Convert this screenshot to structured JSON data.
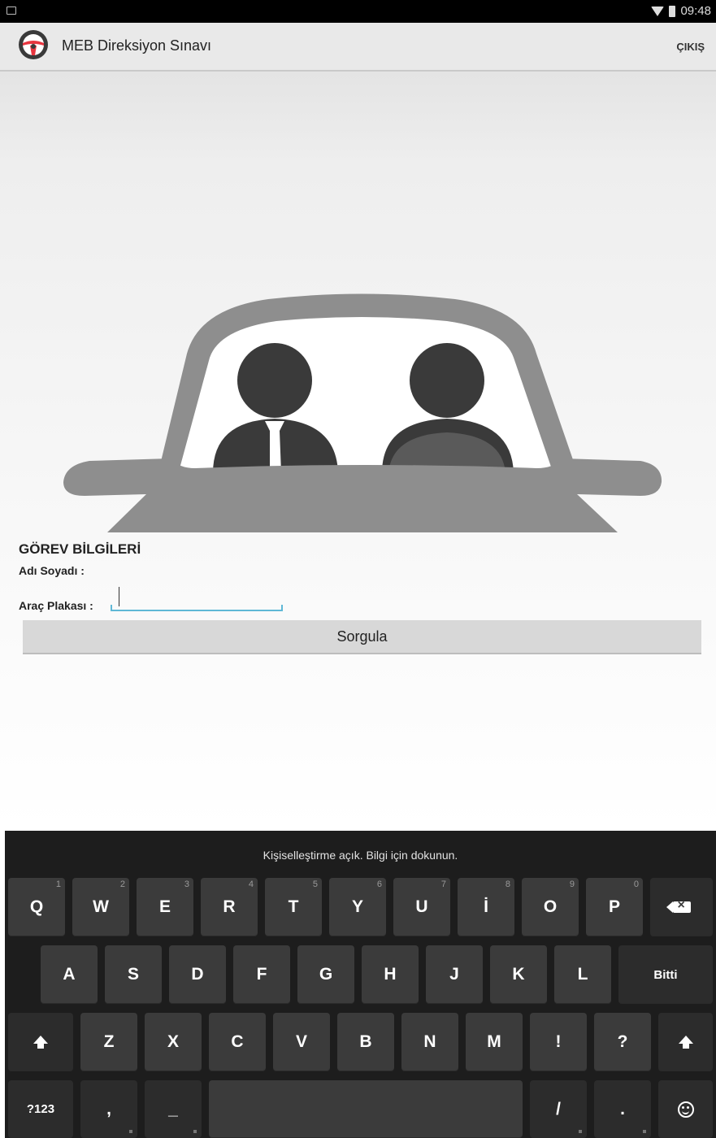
{
  "status_bar": {
    "time": "09:48",
    "icons": [
      "notification-icon",
      "wifi-icon",
      "battery-icon"
    ]
  },
  "app_bar": {
    "title": "MEB Direksiyon Sınavı",
    "logo_icon": "steering-wheel-icon",
    "exit_label": "ÇIKIŞ"
  },
  "illustration": {
    "description_icon": "car-with-driver-and-examiner-illustration"
  },
  "form": {
    "section_title": "GÖREV BİLGİLERİ",
    "name_label": "Adı Soyadı :",
    "name_value": "",
    "plate_label": "Araç Plakası :",
    "plate_value": "",
    "submit_label": "Sorgula"
  },
  "keyboard": {
    "hint": "Kişiselleştirme açık. Bilgi için dokunun.",
    "row1": [
      {
        "k": "Q",
        "n": "1"
      },
      {
        "k": "W",
        "n": "2"
      },
      {
        "k": "E",
        "n": "3"
      },
      {
        "k": "R",
        "n": "4"
      },
      {
        "k": "T",
        "n": "5"
      },
      {
        "k": "Y",
        "n": "6"
      },
      {
        "k": "U",
        "n": "7"
      },
      {
        "k": "İ",
        "n": "8"
      },
      {
        "k": "O",
        "n": "9"
      },
      {
        "k": "P",
        "n": "0"
      }
    ],
    "row2": [
      "A",
      "S",
      "D",
      "F",
      "G",
      "H",
      "J",
      "K",
      "L"
    ],
    "done_label": "Bitti",
    "row3": [
      "Z",
      "X",
      "C",
      "V",
      "B",
      "N",
      "M",
      "!",
      "?"
    ],
    "symbols_label": "?123",
    "comma": ",",
    "dash": "_",
    "slash": "/",
    "period": "."
  },
  "colors": {
    "accent": "#5fb8d6",
    "logo_red": "#e8353f",
    "car_gray": "#8e8e8e",
    "person_dark": "#3a3a3a"
  }
}
